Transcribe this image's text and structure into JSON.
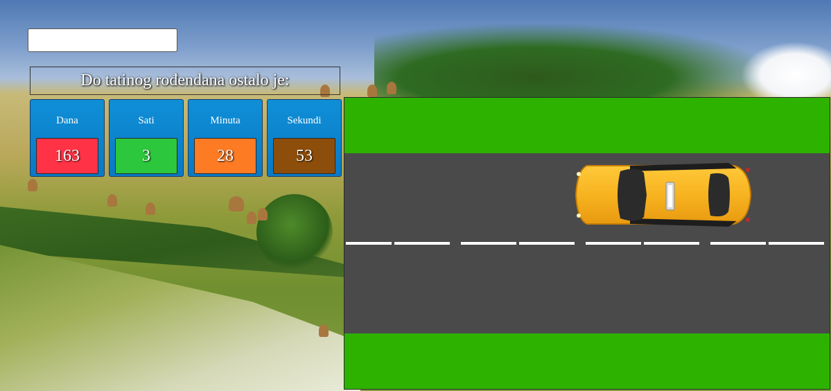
{
  "name_input": {
    "value": "",
    "placeholder": ""
  },
  "heading": {
    "text": "Do tatinog rođendana ostalo je:"
  },
  "countdown": [
    {
      "label": "Dana",
      "value": "163",
      "color": "#ff3345"
    },
    {
      "label": "Sati",
      "value": "3",
      "color": "#2dc73d"
    },
    {
      "label": "Minuta",
      "value": "28",
      "color": "#fd7b23"
    },
    {
      "label": "Sekundi",
      "value": "53",
      "color": "#8d4e0b"
    }
  ],
  "colors": {
    "counter_bg": "#0a82cd",
    "grass": "#2eb200",
    "asphalt": "#4a4a4a",
    "lane_marking": "#ffffff",
    "taxi": "#f7b320"
  },
  "icons": {
    "car": "taxi-car-icon"
  }
}
